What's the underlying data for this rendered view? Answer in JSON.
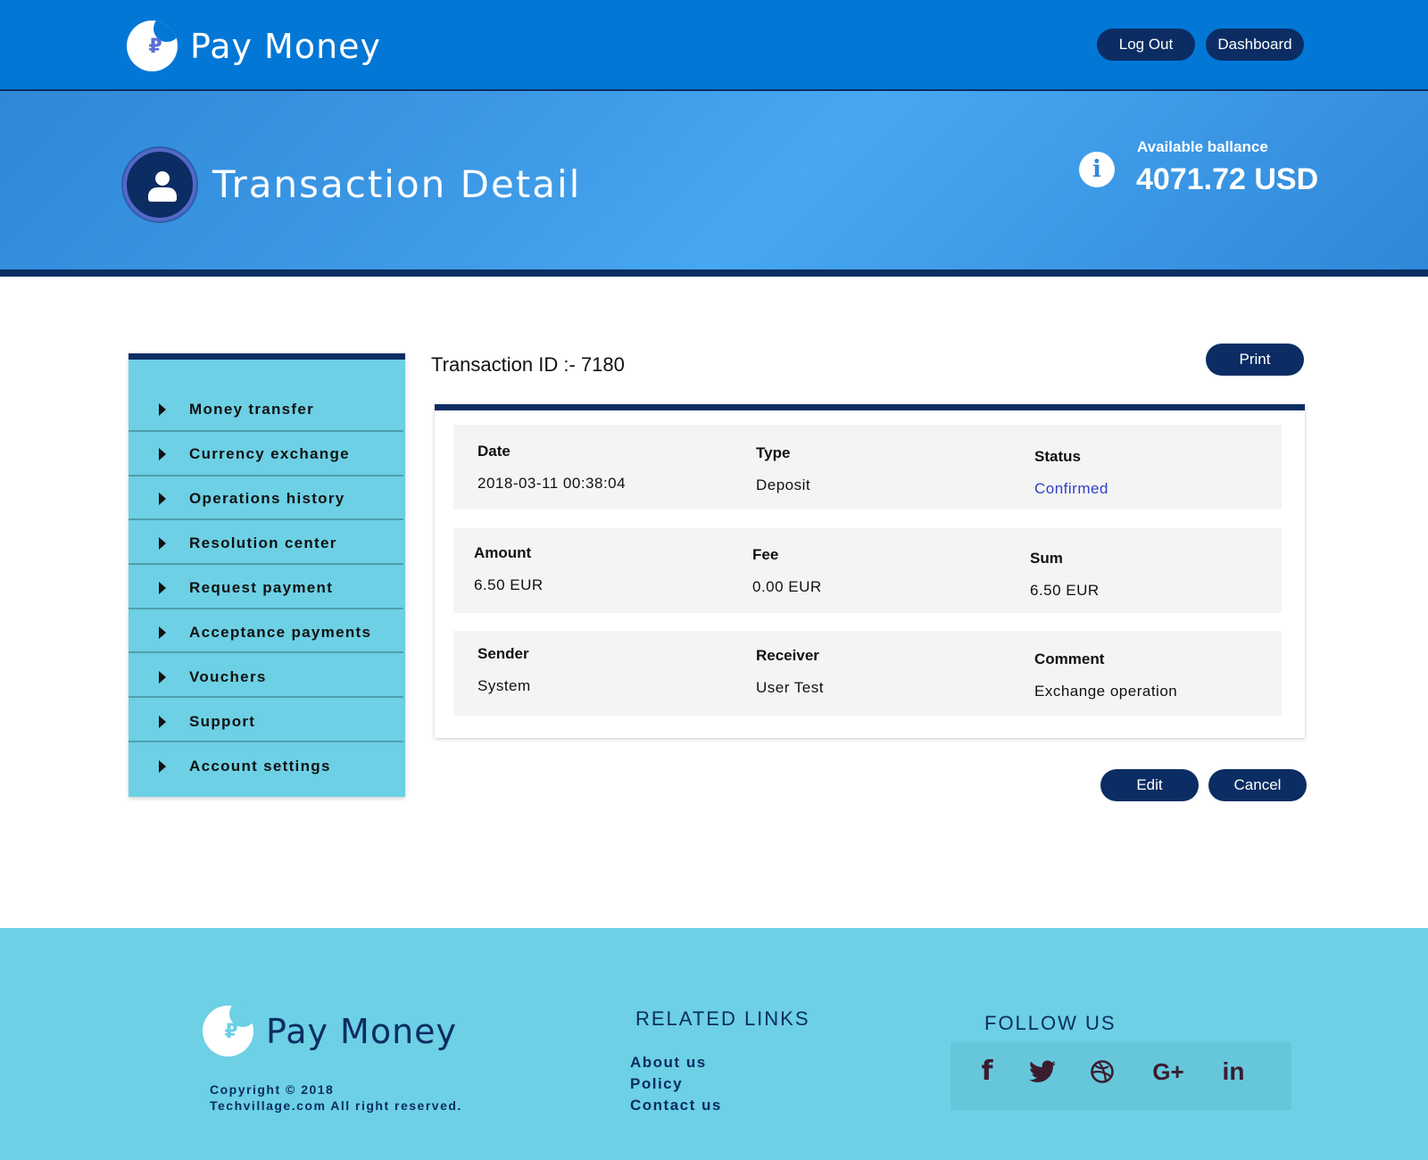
{
  "brand": {
    "name": "Pay Money"
  },
  "header": {
    "logout_label": "Log Out",
    "dashboard_label": "Dashboard"
  },
  "banner": {
    "title": "Transaction Detail",
    "balance_label": "Available ballance",
    "balance_value": "4071.72 USD"
  },
  "sidebar": {
    "items": [
      {
        "label": "Money transfer"
      },
      {
        "label": "Currency exchange"
      },
      {
        "label": "Operations history"
      },
      {
        "label": "Resolution center"
      },
      {
        "label": "Request payment"
      },
      {
        "label": "Acceptance payments"
      },
      {
        "label": "Vouchers"
      },
      {
        "label": "Support"
      },
      {
        "label": "Account settings"
      }
    ]
  },
  "transaction": {
    "id_text": "Transaction ID :- 7180",
    "print_label": "Print",
    "rows": [
      [
        {
          "header": "Date",
          "value": "2018-03-11 00:38:04"
        },
        {
          "header": "Type",
          "value": "Deposit"
        },
        {
          "header": "Status",
          "value": "Confirmed"
        }
      ],
      [
        {
          "header": "Amount",
          "value": "6.50 EUR"
        },
        {
          "header": "Fee",
          "value": "0.00 EUR"
        },
        {
          "header": "Sum",
          "value": "6.50 EUR"
        }
      ],
      [
        {
          "header": "Sender",
          "value": "System"
        },
        {
          "header": "Receiver",
          "value": "User Test"
        },
        {
          "header": "Comment",
          "value": "Exchange operation"
        }
      ]
    ],
    "edit_label": "Edit",
    "cancel_label": "Cancel"
  },
  "footer": {
    "copyright_line1": "Copyright © 2018",
    "copyright_line2": "Techvillage.com  All right reserved.",
    "related_heading": "RELATED LINKS",
    "links": [
      {
        "label": "About us"
      },
      {
        "label": "Policy"
      },
      {
        "label": "Contact us"
      }
    ],
    "follow_heading": "FOLLOW US",
    "social": [
      {
        "icon": "facebook-icon",
        "glyph": "f"
      },
      {
        "icon": "twitter-icon",
        "glyph": ""
      },
      {
        "icon": "dribbble-icon",
        "glyph": ""
      },
      {
        "icon": "google-plus-icon",
        "glyph": "G+"
      },
      {
        "icon": "linkedin-icon",
        "glyph": "in"
      }
    ]
  },
  "colors": {
    "header_bg": "#0277d6",
    "dark_navy": "#0b2d63",
    "sidebar_bg": "#6dd0e4",
    "status_confirmed": "#2f41c9"
  }
}
